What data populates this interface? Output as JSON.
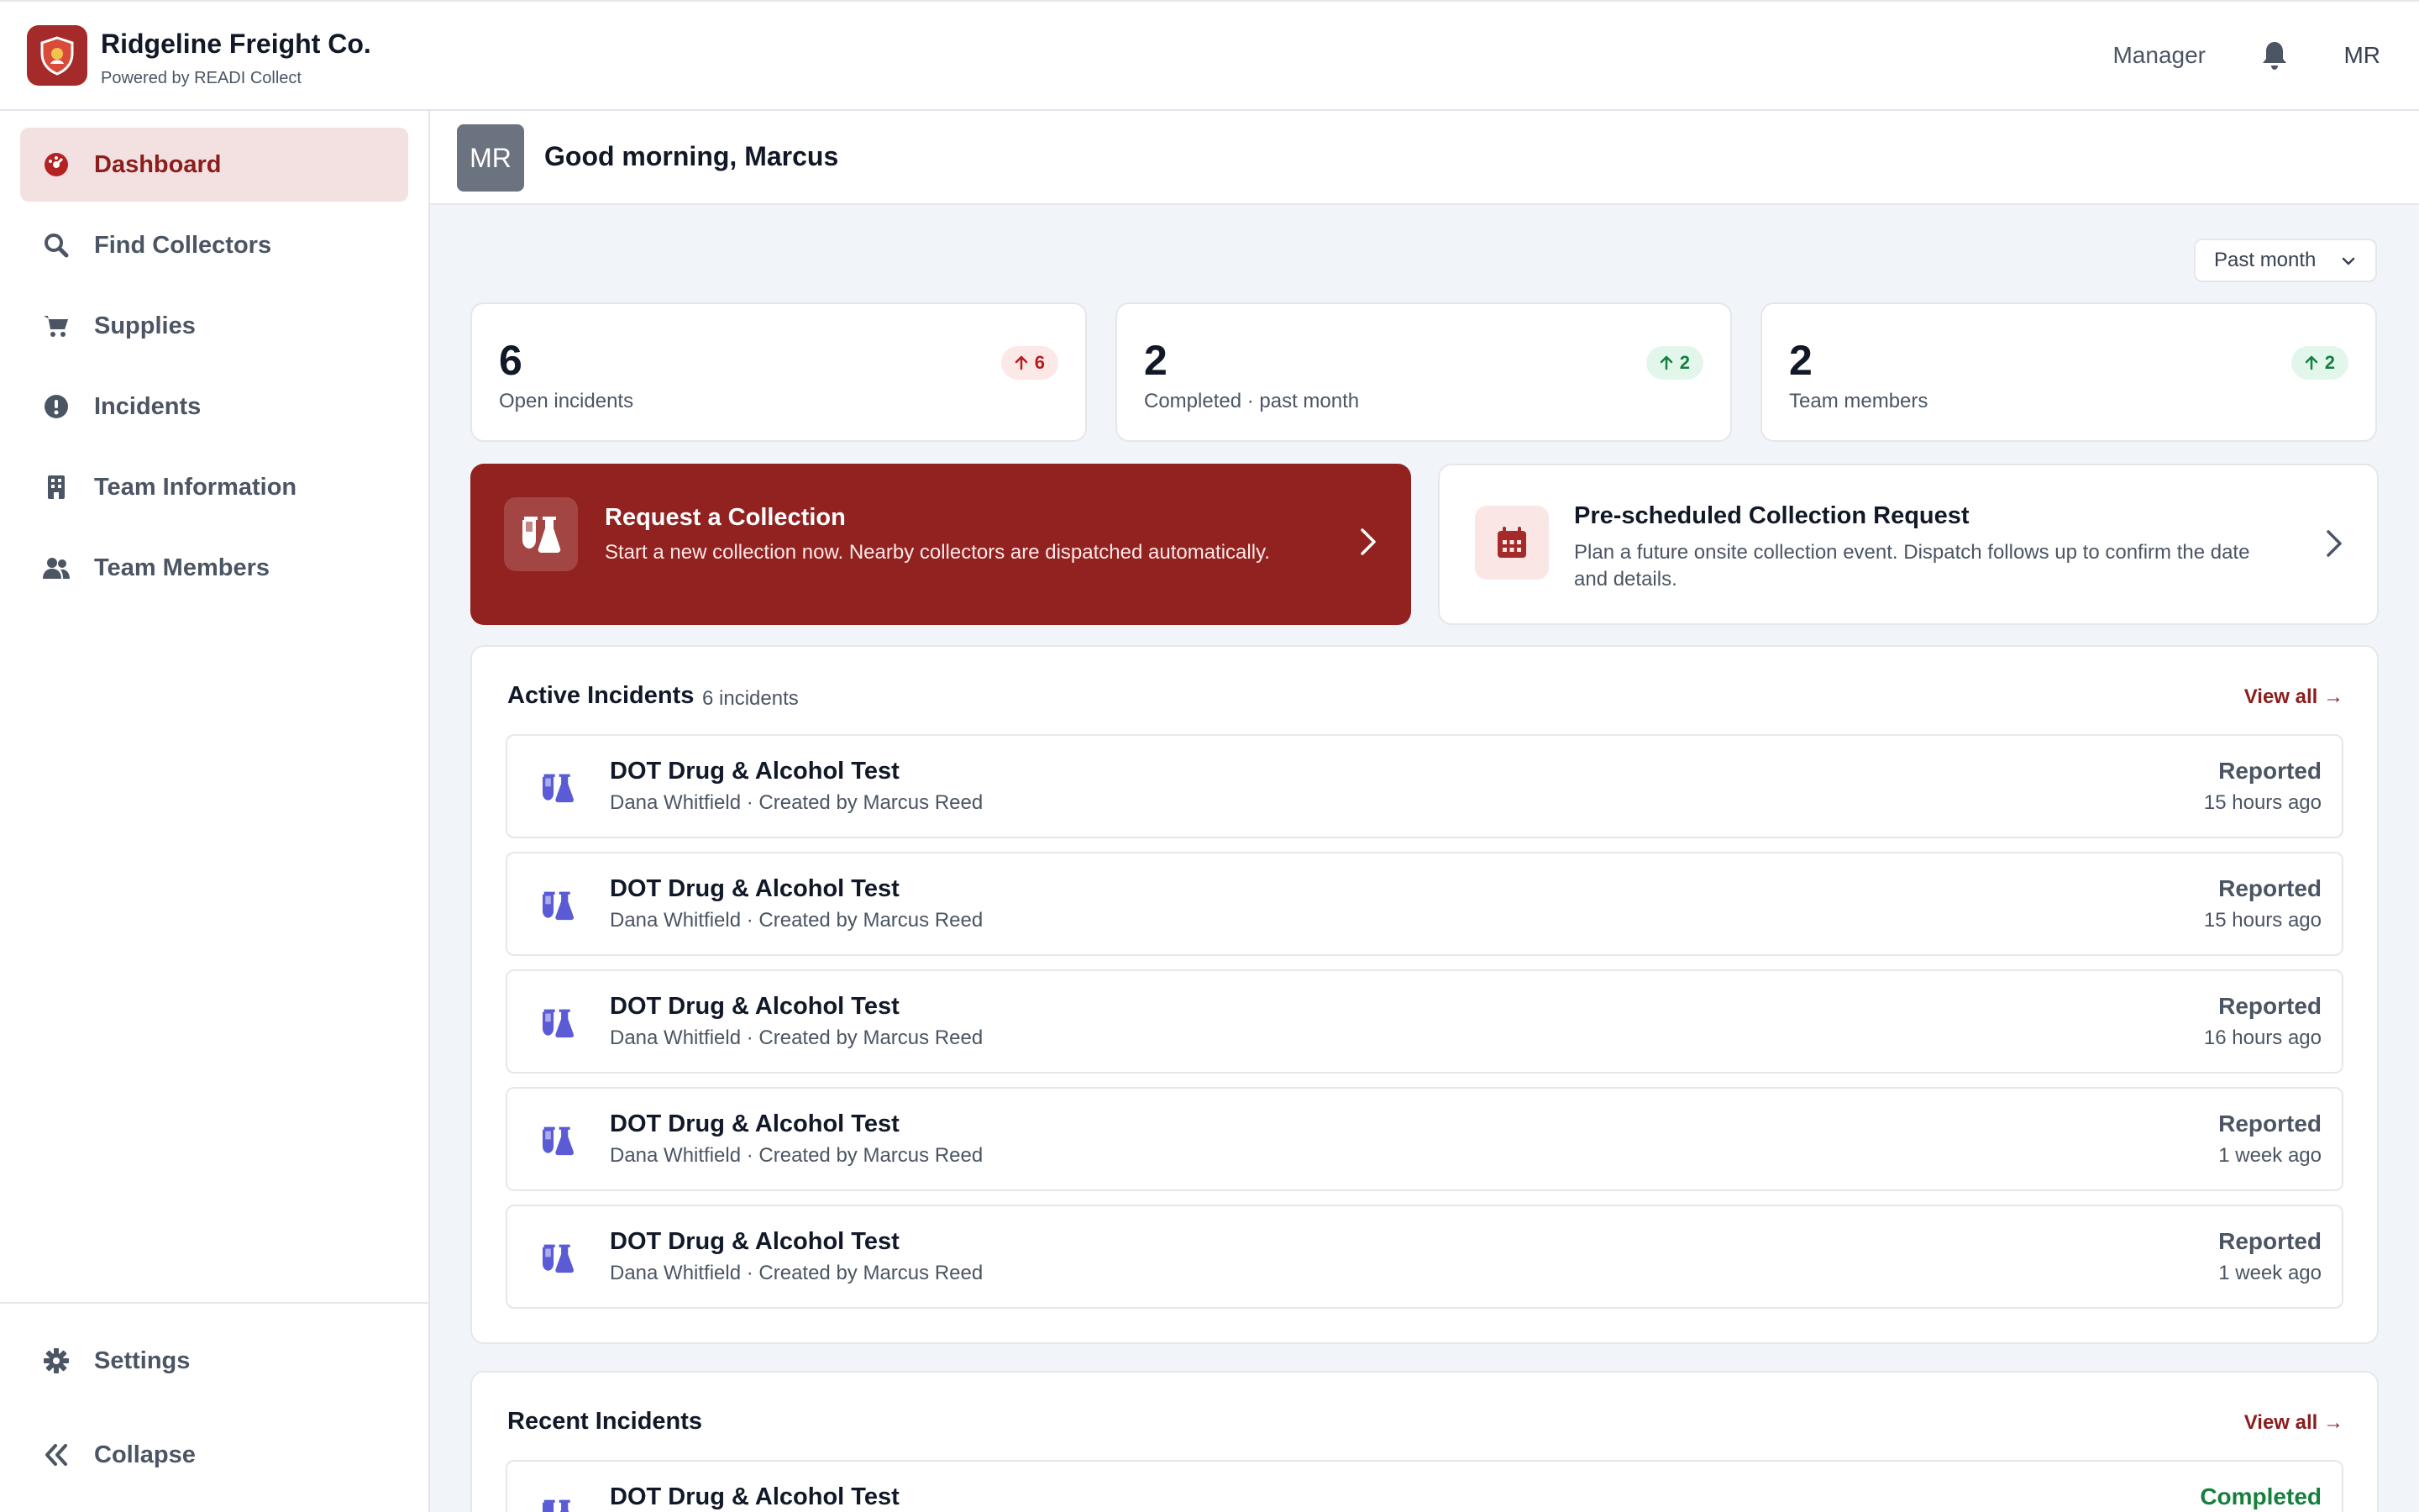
{
  "app": {
    "company": "Ridgeline Freight Co.",
    "powered_by": "Powered by READI Collect",
    "role": "Manager",
    "user_initials": "MR"
  },
  "sidebar": {
    "items": [
      {
        "label": "Dashboard",
        "icon": "dashboard-icon",
        "active": true
      },
      {
        "label": "Find Collectors",
        "icon": "search-icon"
      },
      {
        "label": "Supplies",
        "icon": "cart-icon"
      },
      {
        "label": "Incidents",
        "icon": "alert-icon"
      },
      {
        "label": "Team Information",
        "icon": "building-icon"
      },
      {
        "label": "Team Members",
        "icon": "users-icon"
      }
    ],
    "settings_label": "Settings",
    "collapse_label": "Collapse"
  },
  "greeting": {
    "avatar": "MR",
    "text": "Good morning, Marcus"
  },
  "filter": {
    "period": "Past month"
  },
  "stats": [
    {
      "value": "6",
      "label": "Open incidents",
      "badge": "6",
      "trend": "up",
      "color": "#b91c1c"
    },
    {
      "value": "2",
      "label": "Completed · past month",
      "badge": "2",
      "trend": "up",
      "color": "#15803d"
    },
    {
      "value": "2",
      "label": "Team members",
      "badge": "2",
      "trend": "up",
      "color": "#15803d"
    }
  ],
  "actions": {
    "request": {
      "title": "Request a Collection",
      "desc": "Start a new collection now. Nearby collectors are dispatched automatically."
    },
    "prescheduled": {
      "title": "Pre-scheduled Collection Request",
      "desc": "Plan a future onsite collection event. Dispatch follows up to confirm the date and details."
    }
  },
  "active_incidents": {
    "title": "Active Incidents",
    "count": "6 incidents",
    "view_all": "View all →",
    "rows": [
      {
        "title": "DOT Drug & Alcohol Test",
        "sub": "Dana Whitfield · Created by Marcus Reed",
        "status": "Reported",
        "time": "15 hours ago"
      },
      {
        "title": "DOT Drug & Alcohol Test",
        "sub": "Dana Whitfield · Created by Marcus Reed",
        "status": "Reported",
        "time": "15 hours ago"
      },
      {
        "title": "DOT Drug & Alcohol Test",
        "sub": "Dana Whitfield · Created by Marcus Reed",
        "status": "Reported",
        "time": "16 hours ago"
      },
      {
        "title": "DOT Drug & Alcohol Test",
        "sub": "Dana Whitfield · Created by Marcus Reed",
        "status": "Reported",
        "time": "1 week ago"
      },
      {
        "title": "DOT Drug & Alcohol Test",
        "sub": "Dana Whitfield · Created by Marcus Reed",
        "status": "Reported",
        "time": "1 week ago"
      }
    ]
  },
  "recent_incidents": {
    "title": "Recent Incidents",
    "view_all": "View all →",
    "rows": [
      {
        "title": "DOT Drug & Alcohol Test",
        "status": "Completed"
      }
    ]
  },
  "colors": {
    "brand": "#922220",
    "accent_text": "#8b1d1d",
    "icon_purple": "#5b5bd6",
    "success": "#15803d"
  }
}
